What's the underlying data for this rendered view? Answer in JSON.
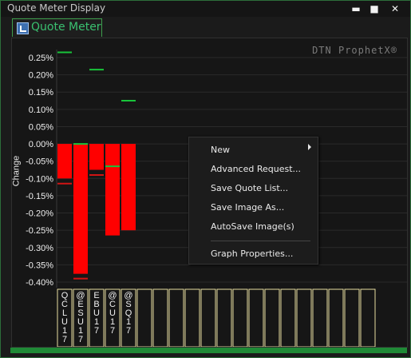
{
  "window": {
    "title": "Quote Meter Display",
    "buttons": {
      "close": "✕",
      "minimize": "▬",
      "maximize": "■"
    }
  },
  "tab": {
    "label": "Quote Meter",
    "icon": "chart-icon"
  },
  "watermark": "DTN ProphetX®",
  "chart_data": {
    "type": "bar",
    "ylabel": "Change",
    "ylim": [
      -0.4,
      0.25
    ],
    "y_ticks": [
      "0.25%",
      "0.20%",
      "0.15%",
      "0.10%",
      "0.05%",
      "0.00%",
      "-0.05%",
      "-0.10%",
      "-0.15%",
      "-0.20%",
      "-0.25%",
      "-0.30%",
      "-0.35%",
      "-0.40%"
    ],
    "y_tick_values": [
      0.25,
      0.2,
      0.15,
      0.1,
      0.05,
      0.0,
      -0.05,
      -0.1,
      -0.15,
      -0.2,
      -0.25,
      -0.3,
      -0.35,
      -0.4
    ],
    "categories": [
      "QCLU17",
      "@ESU17",
      "EBU17",
      "@CU17",
      "@SQ17"
    ],
    "values": [
      -0.1,
      -0.376,
      -0.075,
      -0.265,
      -0.25
    ],
    "markers": {
      "high": [
        0.265,
        0.0,
        0.215,
        -0.065,
        0.125
      ],
      "low": [
        -0.115,
        -0.39,
        -0.09,
        null,
        null
      ]
    },
    "empty_slots": 15,
    "grid": true,
    "colors": {
      "bar": "#ff0000",
      "high_marker": "#18c43a",
      "low_marker": "#d11414",
      "axis_text": "#f0f0f0",
      "background": "#161616",
      "slot_border": "#e8dfa0"
    }
  },
  "context_menu": {
    "items": [
      {
        "label": "New",
        "submenu": true
      },
      {
        "label": "Advanced Request..."
      },
      {
        "label": "Save Quote List..."
      },
      {
        "label": "Save Image As..."
      },
      {
        "label": "AutoSave Image(s)"
      },
      {
        "label": "Graph Properties..."
      }
    ]
  }
}
